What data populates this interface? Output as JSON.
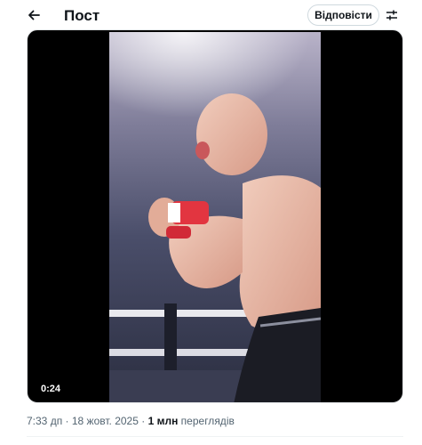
{
  "header": {
    "back_icon": "arrow-left-icon",
    "title": "Пост",
    "reply_label": "Відповісти",
    "settings_icon": "sliders-icon"
  },
  "video": {
    "duration": "0:24",
    "colors": {
      "bars": "#000000",
      "skin": "#e8b8a5",
      "wrap": "#e23540",
      "arena": "#4a4e6a"
    }
  },
  "meta": {
    "time": "7:33 дп",
    "separator1": " · ",
    "date": "18 жовт. 2025",
    "separator2": " · ",
    "views_count": "1 млн",
    "views_label": " переглядів"
  }
}
